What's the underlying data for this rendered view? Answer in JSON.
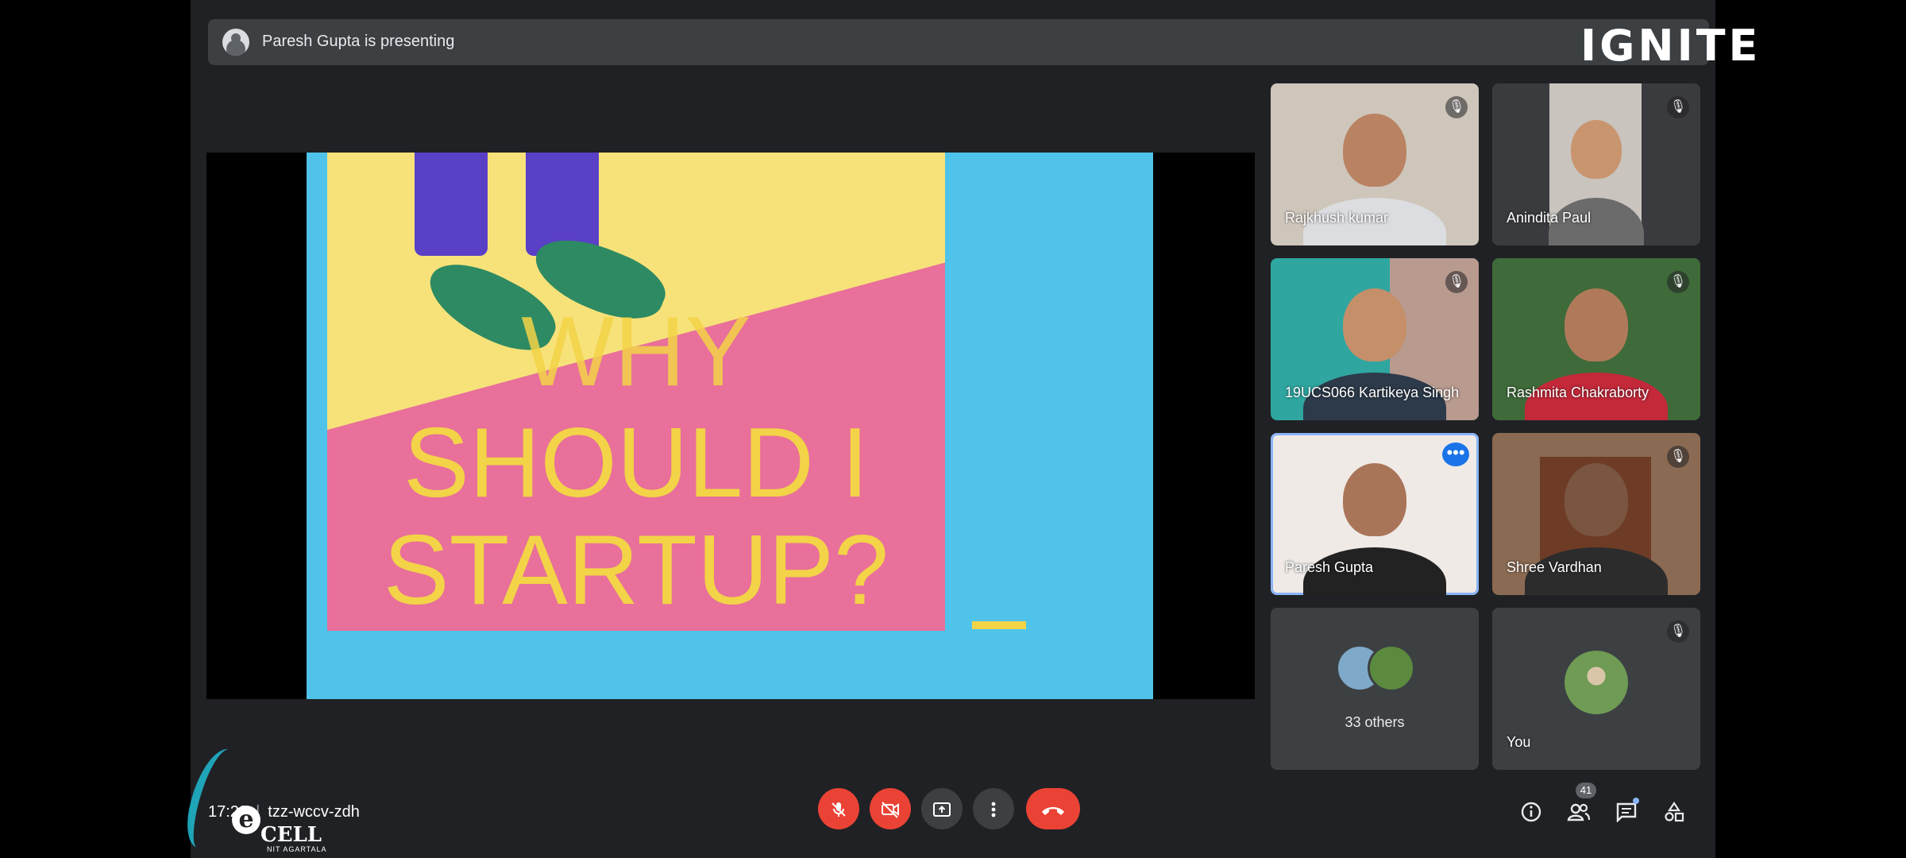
{
  "banner": {
    "presenting_text": "Paresh Gupta is presenting"
  },
  "brand": {
    "ignite_logo": "IGNITE"
  },
  "slide": {
    "line1": "WHY",
    "line2": "SHOULD I",
    "line3": "STARTUP?"
  },
  "participants": [
    {
      "name": "Rajkhush kumar",
      "muted": true
    },
    {
      "name": "Anindita Paul",
      "muted": true
    },
    {
      "name": "19UCS066 Kartikeya Singh",
      "muted": true
    },
    {
      "name": "Rashmita Chakraborty",
      "muted": true
    },
    {
      "name": "Paresh Gupta",
      "muted": false,
      "speaking": true
    },
    {
      "name": "Shree Vardhan",
      "muted": true
    }
  ],
  "others": {
    "label": "33 others"
  },
  "self": {
    "label": "You"
  },
  "meeting": {
    "time": "17:29",
    "code": "tzz-wccv-zdh"
  },
  "logo": {
    "e": "e",
    "cell": "CELL",
    "nit": "NIT AGARTALA"
  },
  "controls": {
    "mic_icon": "mic-off-icon",
    "cam_icon": "camera-off-icon",
    "present_icon": "present-now-icon",
    "more_icon": "more-options-icon",
    "leave_icon": "leave-call-icon"
  },
  "people_count": "41",
  "colors": {
    "danger": "#ea4335",
    "accent": "#1a73e8",
    "slide_bg": "#4fc3e9",
    "slide_text": "#f3d347"
  }
}
